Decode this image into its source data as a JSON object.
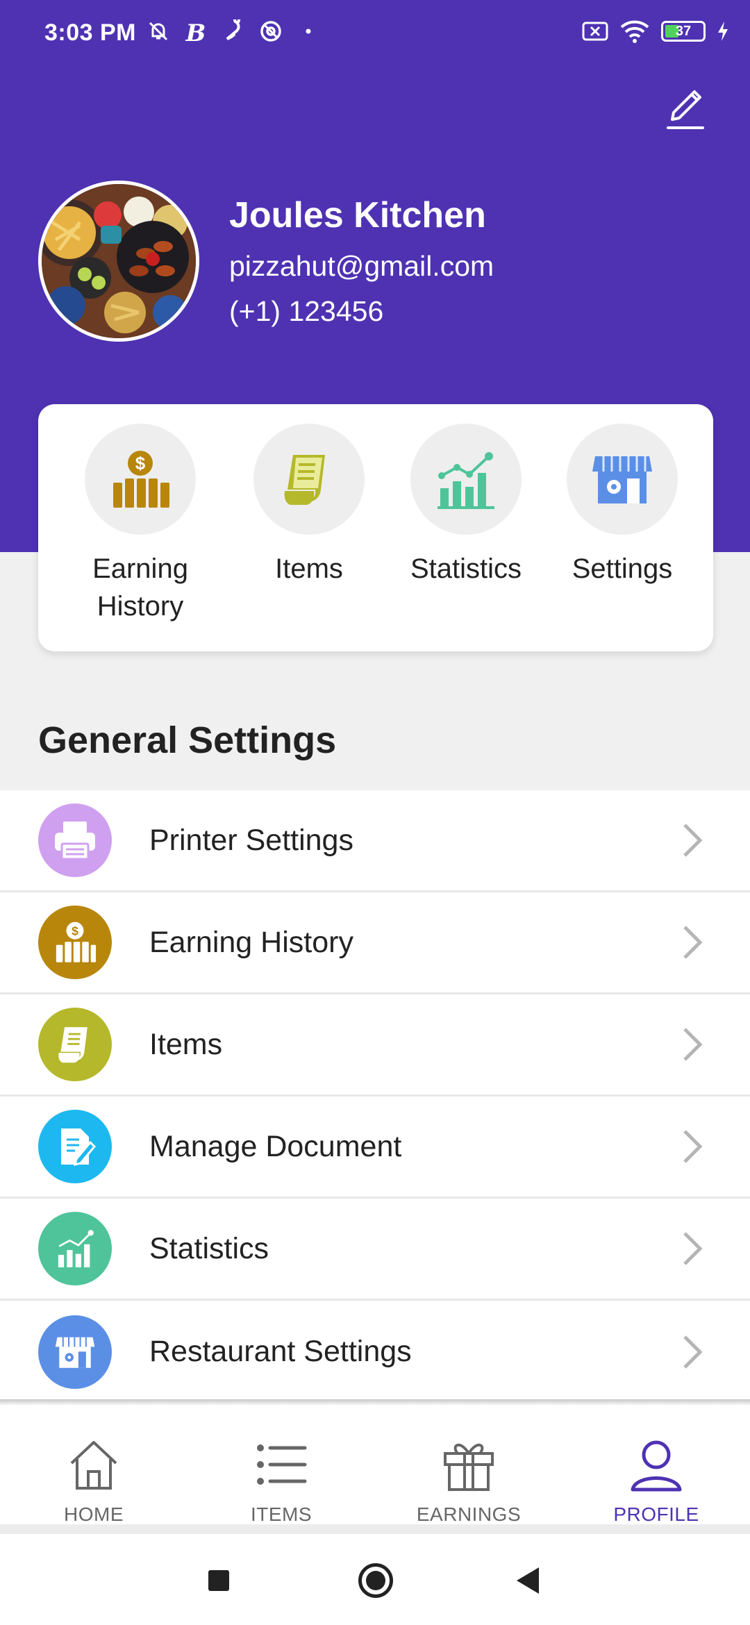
{
  "status_bar": {
    "time": "3:03 PM",
    "left_icons": [
      "mute-icon",
      "b-icon",
      "notification-icon",
      "at-icon",
      "dot-icon"
    ],
    "right_icons": [
      "close-box-icon",
      "wifi-icon",
      "battery-icon",
      "charging-icon"
    ],
    "battery_level": "37",
    "battery_fraction": 0.37
  },
  "profile": {
    "name": "Joules Kitchen",
    "email": "pizzahut@gmail.com",
    "phone": "(+1) 123456"
  },
  "quick_actions": [
    {
      "label": "Earning History",
      "icon": "earning-history-icon",
      "color": "#b8860b"
    },
    {
      "label": "Items",
      "icon": "items-receipt-icon",
      "color": "#b5b82a"
    },
    {
      "label": "Statistics",
      "icon": "statistics-icon",
      "color": "#4fc49b"
    },
    {
      "label": "Settings",
      "icon": "store-settings-icon",
      "color": "#5b8fe6"
    }
  ],
  "general_settings": {
    "title": "General Settings",
    "items": [
      {
        "label": "Printer Settings",
        "icon": "printer-icon",
        "bg": "#cfa0f0"
      },
      {
        "label": "Earning History",
        "icon": "earning-history-icon",
        "bg": "#b8860b"
      },
      {
        "label": "Items",
        "icon": "items-receipt-icon",
        "bg": "#b5b82a"
      },
      {
        "label": "Manage Document",
        "icon": "document-icon",
        "bg": "#1db8ef"
      },
      {
        "label": "Statistics",
        "icon": "statistics-icon",
        "bg": "#4fc49b"
      },
      {
        "label": "Restaurant Settings",
        "icon": "store-settings-icon",
        "bg": "#5b8fe6"
      }
    ]
  },
  "bottom_nav": [
    {
      "label": "HOME",
      "icon": "home-icon",
      "active": false
    },
    {
      "label": "ITEMS",
      "icon": "list-icon",
      "active": false
    },
    {
      "label": "EARNINGS",
      "icon": "gift-icon",
      "active": false
    },
    {
      "label": "PROFILE",
      "icon": "user-icon",
      "active": true
    }
  ],
  "colors": {
    "primary": "#4e32b2",
    "background": "#f0f0f0",
    "card": "#ffffff",
    "chevron": "#b5b5b5"
  }
}
